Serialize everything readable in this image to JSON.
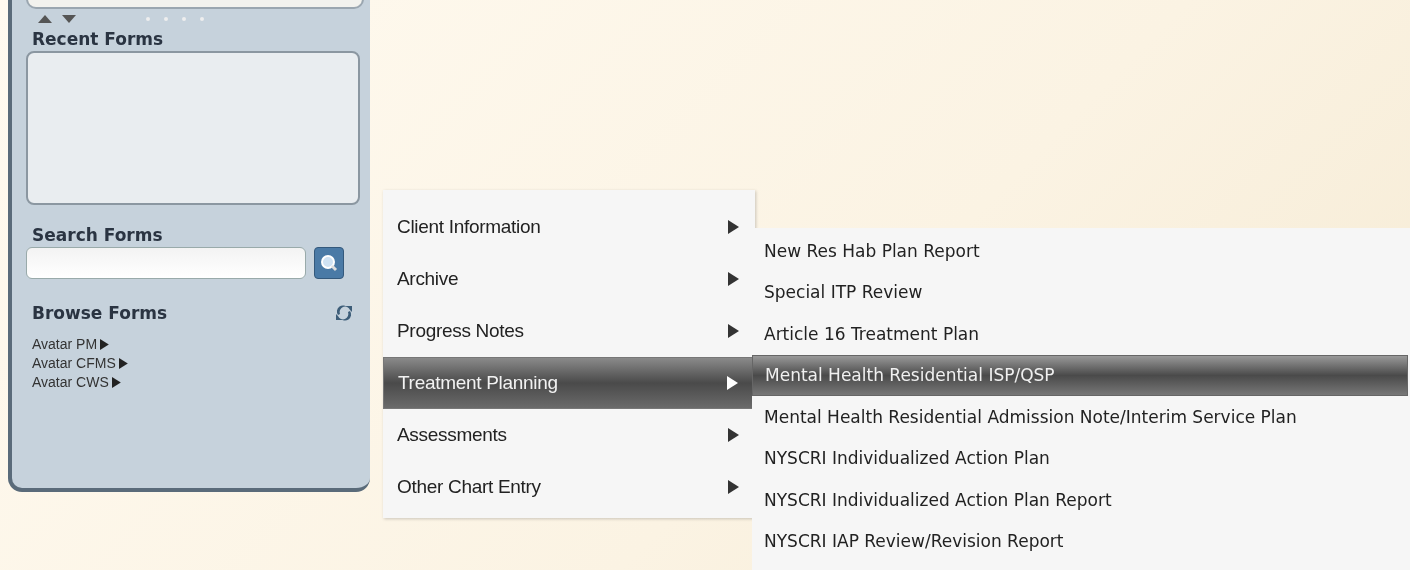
{
  "sidebar": {
    "recent_forms": {
      "title": "Recent Forms"
    },
    "search_forms": {
      "title": "Search Forms"
    },
    "browse_forms": {
      "title": "Browse Forms",
      "items": [
        {
          "label": "Avatar PM"
        },
        {
          "label": "Avatar CFMS"
        },
        {
          "label": "Avatar CWS"
        }
      ]
    }
  },
  "menu": {
    "items": [
      {
        "label": "Client Information",
        "selected": false
      },
      {
        "label": "Archive",
        "selected": false
      },
      {
        "label": "Progress Notes",
        "selected": false
      },
      {
        "label": "Treatment Planning",
        "selected": true
      },
      {
        "label": "Assessments",
        "selected": false
      },
      {
        "label": "Other Chart Entry",
        "selected": false
      }
    ]
  },
  "submenu": {
    "items": [
      {
        "label": "New Res Hab Plan Report",
        "selected": false
      },
      {
        "label": "Special ITP Review",
        "selected": false
      },
      {
        "label": "Article 16 Treatment Plan",
        "selected": false
      },
      {
        "label": "Mental Health Residential ISP/QSP",
        "selected": true
      },
      {
        "label": "Mental Health Residential Admission Note/Interim Service Plan",
        "selected": false
      },
      {
        "label": "NYSCRI Individualized Action Plan",
        "selected": false
      },
      {
        "label": "NYSCRI Individualized Action Plan Report",
        "selected": false
      },
      {
        "label": "NYSCRI IAP Review/Revision Report",
        "selected": false
      }
    ]
  }
}
